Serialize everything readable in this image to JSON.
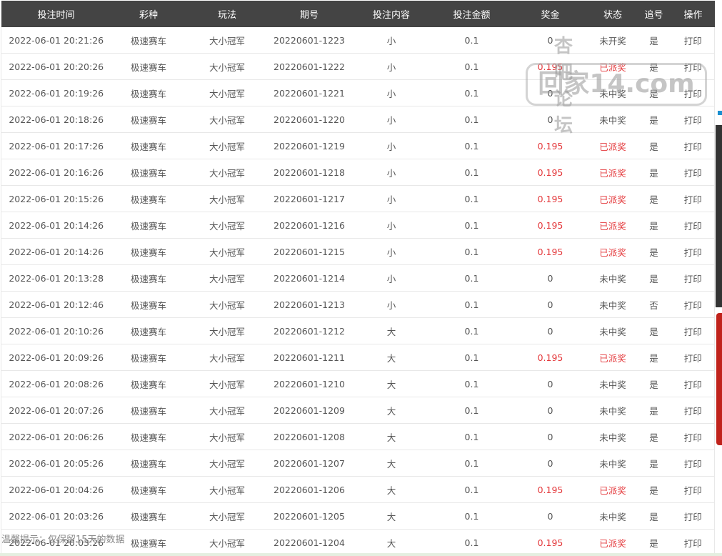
{
  "columns": [
    "投注时间",
    "彩种",
    "玩法",
    "期号",
    "投注内容",
    "投注金额",
    "奖金",
    "状态",
    "追号",
    "操作"
  ],
  "rows": [
    [
      "2022-06-01 20:21:26",
      "极速赛车",
      "大小冠军",
      "20220601-1223",
      "小",
      "0.1",
      "0",
      "未开奖",
      "是",
      "打印"
    ],
    [
      "2022-06-01 20:20:26",
      "极速赛车",
      "大小冠军",
      "20220601-1222",
      "小",
      "0.1",
      "0.195",
      "已派奖",
      "是",
      "打印"
    ],
    [
      "2022-06-01 20:19:26",
      "极速赛车",
      "大小冠军",
      "20220601-1221",
      "小",
      "0.1",
      "0",
      "未中奖",
      "是",
      "打印"
    ],
    [
      "2022-06-01 20:18:26",
      "极速赛车",
      "大小冠军",
      "20220601-1220",
      "小",
      "0.1",
      "0",
      "未中奖",
      "是",
      "打印"
    ],
    [
      "2022-06-01 20:17:26",
      "极速赛车",
      "大小冠军",
      "20220601-1219",
      "小",
      "0.1",
      "0.195",
      "已派奖",
      "是",
      "打印"
    ],
    [
      "2022-06-01 20:16:26",
      "极速赛车",
      "大小冠军",
      "20220601-1218",
      "小",
      "0.1",
      "0.195",
      "已派奖",
      "是",
      "打印"
    ],
    [
      "2022-06-01 20:15:26",
      "极速赛车",
      "大小冠军",
      "20220601-1217",
      "小",
      "0.1",
      "0.195",
      "已派奖",
      "是",
      "打印"
    ],
    [
      "2022-06-01 20:14:26",
      "极速赛车",
      "大小冠军",
      "20220601-1216",
      "小",
      "0.1",
      "0.195",
      "已派奖",
      "是",
      "打印"
    ],
    [
      "2022-06-01 20:14:26",
      "极速赛车",
      "大小冠军",
      "20220601-1215",
      "小",
      "0.1",
      "0.195",
      "已派奖",
      "是",
      "打印"
    ],
    [
      "2022-06-01 20:13:28",
      "极速赛车",
      "大小冠军",
      "20220601-1214",
      "小",
      "0.1",
      "0",
      "未中奖",
      "是",
      "打印"
    ],
    [
      "2022-06-01 20:12:46",
      "极速赛车",
      "大小冠军",
      "20220601-1213",
      "小",
      "0.1",
      "0",
      "未中奖",
      "否",
      "打印"
    ],
    [
      "2022-06-01 20:10:26",
      "极速赛车",
      "大小冠军",
      "20220601-1212",
      "大",
      "0.1",
      "0",
      "未中奖",
      "是",
      "打印"
    ],
    [
      "2022-06-01 20:09:26",
      "极速赛车",
      "大小冠军",
      "20220601-1211",
      "大",
      "0.1",
      "0.195",
      "已派奖",
      "是",
      "打印"
    ],
    [
      "2022-06-01 20:08:26",
      "极速赛车",
      "大小冠军",
      "20220601-1210",
      "大",
      "0.1",
      "0",
      "未中奖",
      "是",
      "打印"
    ],
    [
      "2022-06-01 20:07:26",
      "极速赛车",
      "大小冠军",
      "20220601-1209",
      "大",
      "0.1",
      "0",
      "未中奖",
      "是",
      "打印"
    ],
    [
      "2022-06-01 20:06:26",
      "极速赛车",
      "大小冠军",
      "20220601-1208",
      "大",
      "0.1",
      "0",
      "未中奖",
      "是",
      "打印"
    ],
    [
      "2022-06-01 20:05:26",
      "极速赛车",
      "大小冠军",
      "20220601-1207",
      "大",
      "0.1",
      "0",
      "未中奖",
      "是",
      "打印"
    ],
    [
      "2022-06-01 20:04:26",
      "极速赛车",
      "大小冠军",
      "20220601-1206",
      "大",
      "0.1",
      "0.195",
      "已派奖",
      "是",
      "打印"
    ],
    [
      "2022-06-01 20:03:26",
      "极速赛车",
      "大小冠军",
      "20220601-1205",
      "大",
      "0.1",
      "0",
      "未中奖",
      "是",
      "打印"
    ],
    [
      "2022-06-01 20:03:26",
      "极速赛车",
      "大小冠军",
      "20220601-1204",
      "大",
      "0.1",
      "0.195",
      "已派奖",
      "是",
      "打印"
    ]
  ],
  "note": "温馨提示：仅保留15天的数据",
  "watermark": {
    "top": "杏吧论坛",
    "main": "回家14.com"
  },
  "colors": {
    "header": "#444444",
    "win": "#e4393c"
  }
}
